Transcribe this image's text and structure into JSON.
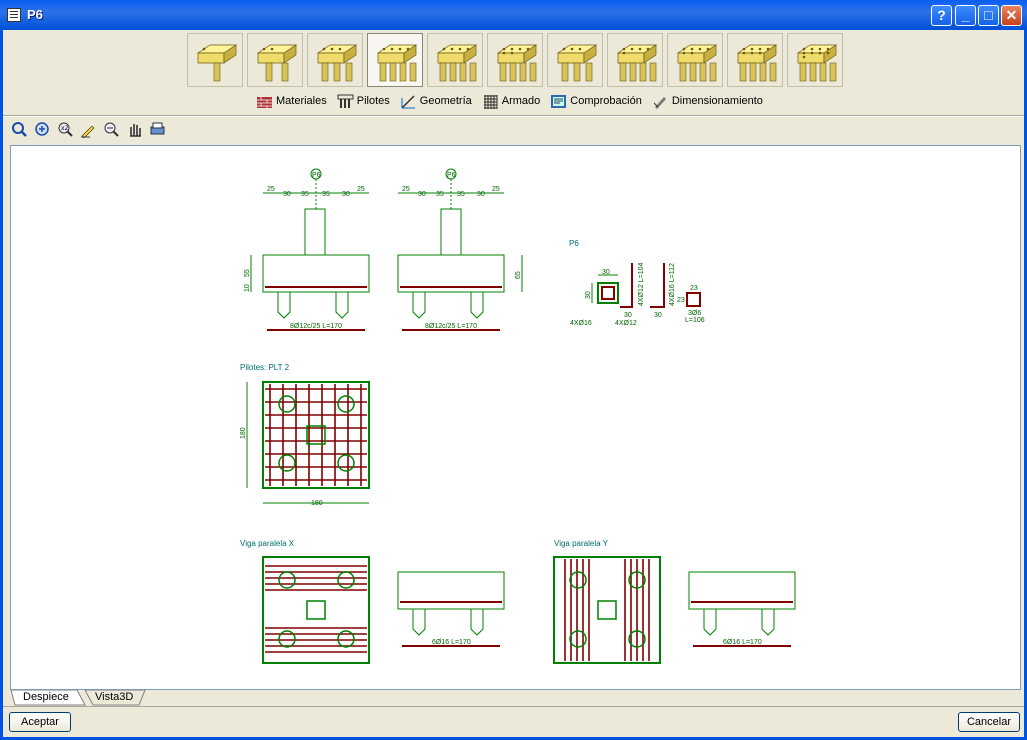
{
  "window": {
    "title": "P6"
  },
  "titlebar_buttons": {
    "help": "?",
    "minimize": "_",
    "maximize": "□",
    "close": "✕"
  },
  "pile_cap_types": [
    "1 pilote",
    "2 pilotes",
    "3 pilotes",
    "4 pilotes",
    "5 pilotes lineal",
    "6 pilotes",
    "3 pilotes triángulo",
    "5 pilotes",
    "6 pilotes hexágono",
    "7 pilotes",
    "9 pilotes"
  ],
  "menu": {
    "items": [
      {
        "label": "Materiales",
        "icon": "materials-icon"
      },
      {
        "label": "Pilotes",
        "icon": "piles-icon"
      },
      {
        "label": "Geometría",
        "icon": "geometry-icon"
      },
      {
        "label": "Armado",
        "icon": "reinforcement-icon"
      },
      {
        "label": "Comprobación",
        "icon": "check-icon"
      },
      {
        "label": "Dimensionamiento",
        "icon": "sizing-icon"
      }
    ]
  },
  "view_tools": [
    "zoom-extents-icon",
    "zoom-window-icon",
    "zoom-x2-icon",
    "edit-icon",
    "zoom-out-icon",
    "pan-icon",
    "print-icon"
  ],
  "drawing": {
    "column_label": "P6",
    "dims_top": [
      "25",
      "30",
      "35",
      "35",
      "30",
      "25"
    ],
    "dim_height_left": "55",
    "dim_height_small": "10",
    "dim_height_right": "65",
    "bar_label_1": "8Ø12c/25 L=170",
    "bar_label_2": "8Ø12c/25 L=170",
    "col_title": "P6",
    "col_dim_30": "30",
    "col_dim_30v": "30",
    "col_bars_a": "4XØ12 L=104",
    "col_bars_b": "4XØ16 L=112",
    "col_label_30a": "30",
    "col_label_30b": "30",
    "col_label_23a": "23",
    "col_label_23b": "23",
    "stirrup_label": "3Ø6",
    "stirrup_len": "L=106",
    "col_label_4x16": "4XØ16",
    "col_label_4x12": "4XØ12",
    "piles_title": "Pilotes: PLT 2",
    "plan_dim_v": "180",
    "plan_dim_h": "180",
    "beam_x_title": "Viga paralela X",
    "beam_y_title": "Viga paralela Y",
    "beam_x_bar": "6Ø16 L=170",
    "beam_y_bar": "6Ø16 L=170"
  },
  "tabs": [
    {
      "label": "Despiece",
      "active": true
    },
    {
      "label": "Vista3D",
      "active": false
    }
  ],
  "buttons": {
    "accept": "Aceptar",
    "cancel": "Cancelar"
  },
  "colors": {
    "steel": "#800000",
    "concrete": "#008000",
    "text": "#006e6e"
  }
}
